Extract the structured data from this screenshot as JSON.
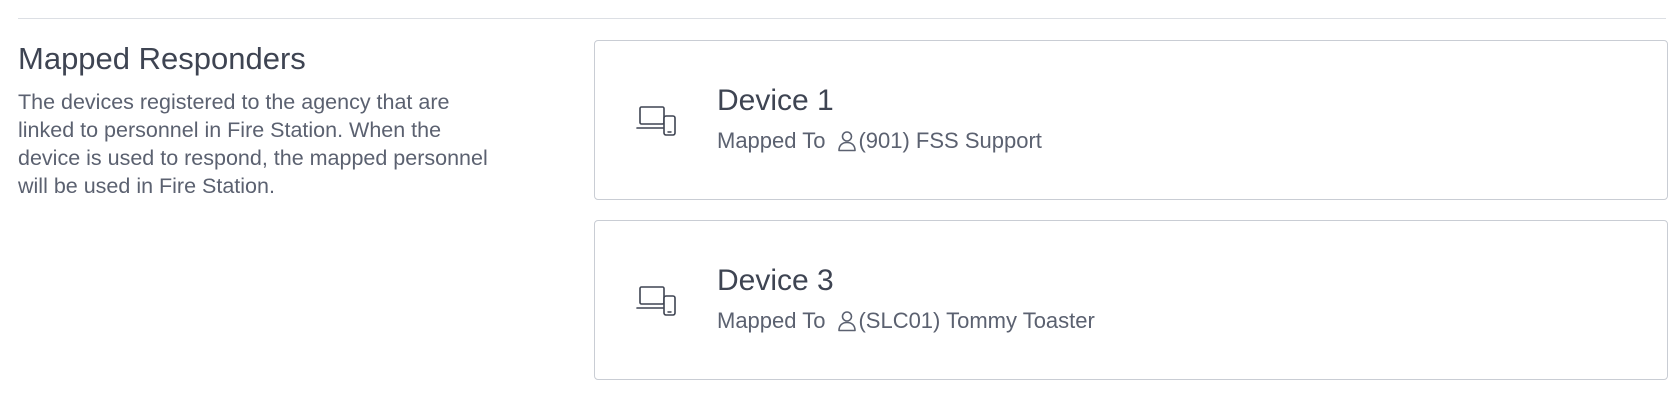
{
  "section": {
    "title": "Mapped Responders",
    "description": "The devices registered to the agency that are linked to personnel in Fire Station. When the device is used to respond, the mapped personnel will be used in Fire Station."
  },
  "devices": [
    {
      "name": "Device 1",
      "mapped_label": "Mapped To",
      "person": "(901) FSS Support",
      "icon": "laptop-phone-icon"
    },
    {
      "name": "Device 3",
      "mapped_label": "Mapped To",
      "person": "(SLC01) Tommy Toaster",
      "icon": "laptop-phone-icon"
    }
  ],
  "colors": {
    "text_primary": "#3e4452",
    "text_secondary": "#5b6170",
    "border": "#c9cdd4",
    "divider": "#dcdfe4"
  }
}
